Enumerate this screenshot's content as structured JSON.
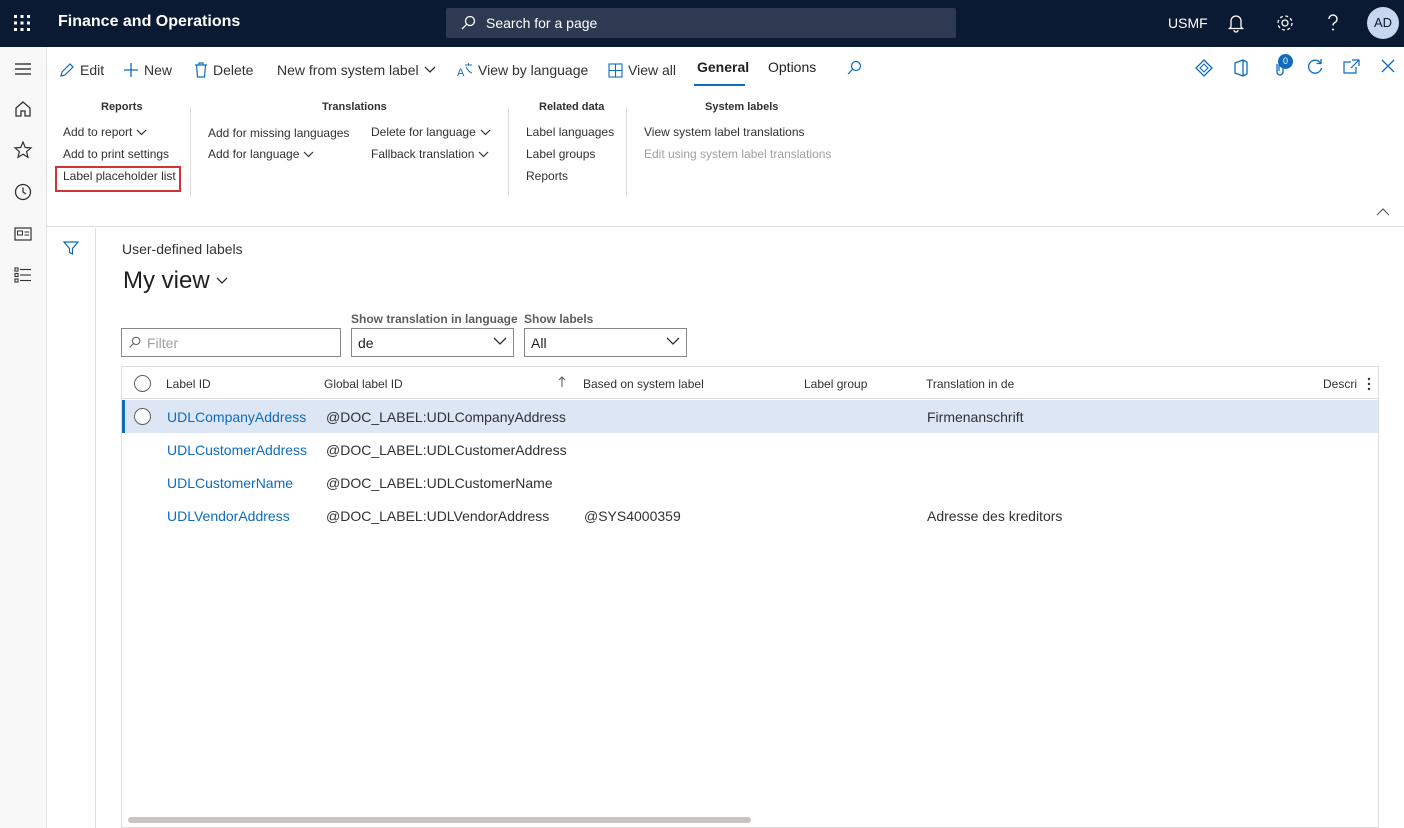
{
  "topbar": {
    "app_title": "Finance and Operations",
    "search_placeholder": "Search for a page",
    "company": "USMF",
    "avatar_initials": "AD"
  },
  "actions": {
    "edit": "Edit",
    "new": "New",
    "delete": "Delete",
    "new_from_system_label": "New from system label",
    "view_by_language": "View by language",
    "view_all": "View all",
    "tab_general": "General",
    "tab_options": "Options",
    "attachments_count": "0"
  },
  "groups": {
    "reports": {
      "title": "Reports",
      "items": [
        "Add to report",
        "Add to print settings",
        "Label placeholder list"
      ]
    },
    "translations": {
      "title": "Translations",
      "items": [
        "Add for missing languages",
        "Add for language",
        "Delete for language",
        "Fallback translation"
      ]
    },
    "related": {
      "title": "Related data",
      "items": [
        "Label languages",
        "Label groups",
        "Reports"
      ]
    },
    "system": {
      "title": "System labels",
      "items": [
        "View system label translations",
        "Edit using system label translations"
      ]
    }
  },
  "page": {
    "caption": "User-defined labels",
    "view_name": "My view"
  },
  "filters": {
    "filter_placeholder": "Filter",
    "lang_label": "Show translation in language",
    "lang_value": "de",
    "show_labels_label": "Show labels",
    "show_labels_value": "All"
  },
  "grid": {
    "columns": [
      "Label ID",
      "Global label ID",
      "Based on system label",
      "Label group",
      "Translation in de",
      "Descri"
    ],
    "rows": [
      {
        "label_id": "UDLCompanyAddress",
        "global_id": "@DOC_LABEL:UDLCompanyAddress",
        "system_label": "",
        "group": "",
        "translation": "Firmenanschrift"
      },
      {
        "label_id": "UDLCustomerAddress",
        "global_id": "@DOC_LABEL:UDLCustomerAddress",
        "system_label": "",
        "group": "",
        "translation": ""
      },
      {
        "label_id": "UDLCustomerName",
        "global_id": "@DOC_LABEL:UDLCustomerName",
        "system_label": "",
        "group": "",
        "translation": ""
      },
      {
        "label_id": "UDLVendorAddress",
        "global_id": "@DOC_LABEL:UDLVendorAddress",
        "system_label": "@SYS4000359",
        "group": "",
        "translation": "Adresse des kreditors"
      }
    ]
  },
  "colors": {
    "topbar": "#0a1a33",
    "accent": "#0f6cbd",
    "selected_row": "#dce6f4",
    "highlight": "#d13438"
  }
}
